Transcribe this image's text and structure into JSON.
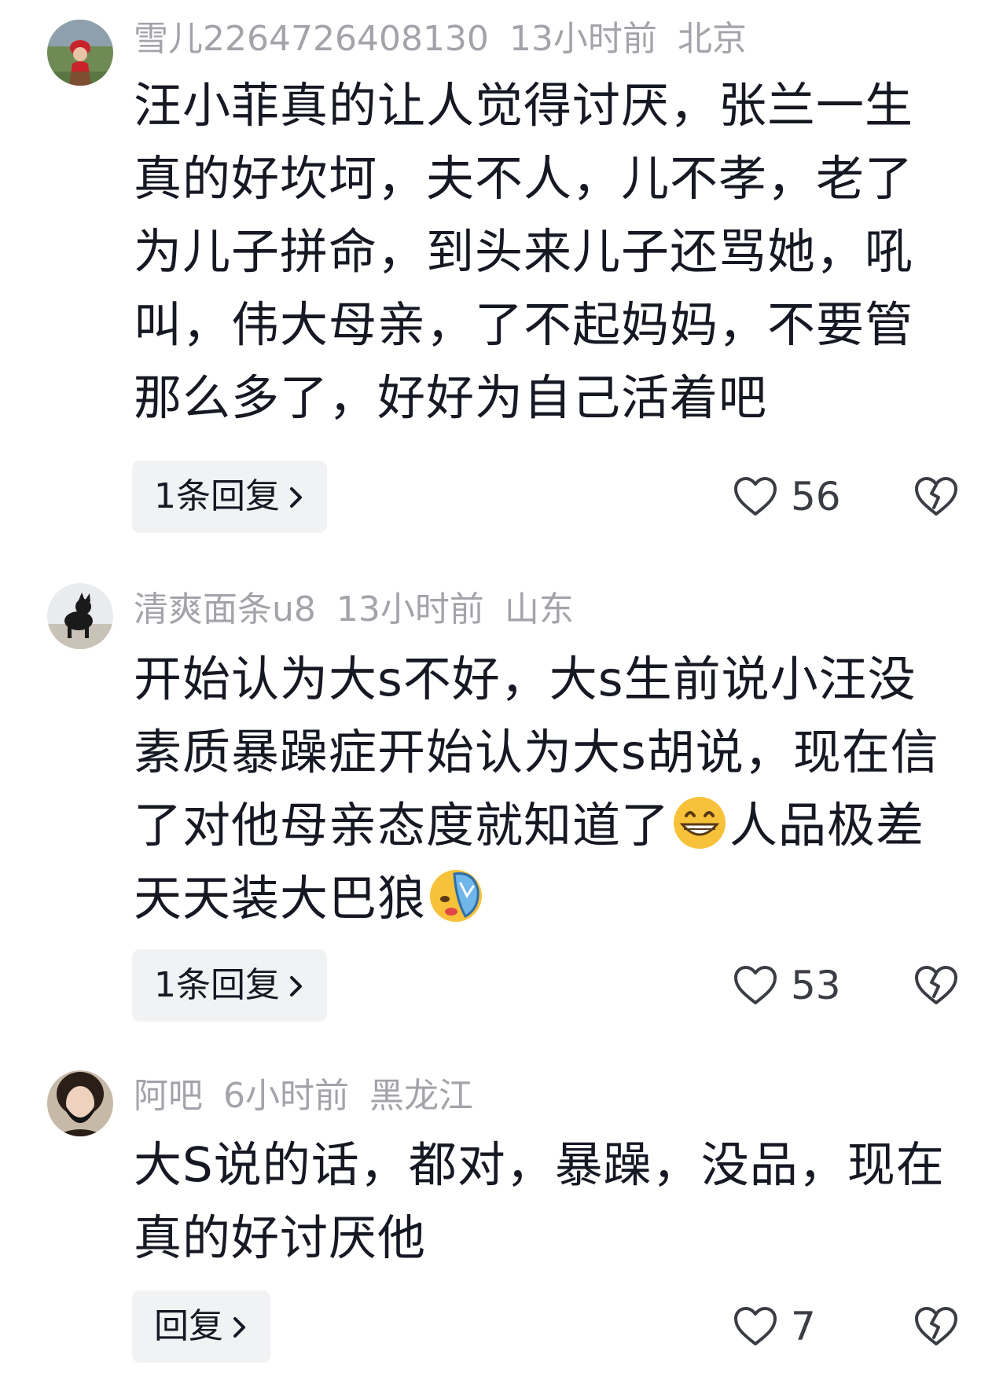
{
  "comments": [
    {
      "username": "雪儿2264726408130",
      "time": "13小时前",
      "location": "北京",
      "lines": [
        "汪小菲真的让人觉得讨厌，张兰一生",
        "真的好坎坷，夫不人，儿不孝，老了",
        "为儿子拼命，到头来儿子还骂她，吼",
        "叫，伟大母亲，了不起妈妈，不要管",
        "那么多了，好好为自己活着吧"
      ],
      "reply_label": "1条回复",
      "likes": "56"
    },
    {
      "username": "清爽面条u8",
      "time": "13小时前",
      "location": "山东",
      "lines": [
        "开始认为大s不好，大s生前说小汪没",
        "素质暴躁症开始认为大s胡说，现在信",
        "了对他母亲态度就知道了",
        "人品极差",
        "天天装大巴狼"
      ],
      "emojis": [
        "grinning-face-emoji",
        "flip-flop-emoji"
      ],
      "reply_label": "1条回复",
      "likes": "53"
    },
    {
      "username": "阿吧",
      "time": "6小时前",
      "location": "黑龙江",
      "lines": [
        "大S说的话，都对，暴躁，没品，现在",
        "真的好讨厌他"
      ],
      "reply_label": "回复",
      "likes": "7"
    }
  ],
  "colors": {
    "meta": "#a3a4aa",
    "text": "#161823",
    "reply_bg": "#f1f2f4"
  }
}
